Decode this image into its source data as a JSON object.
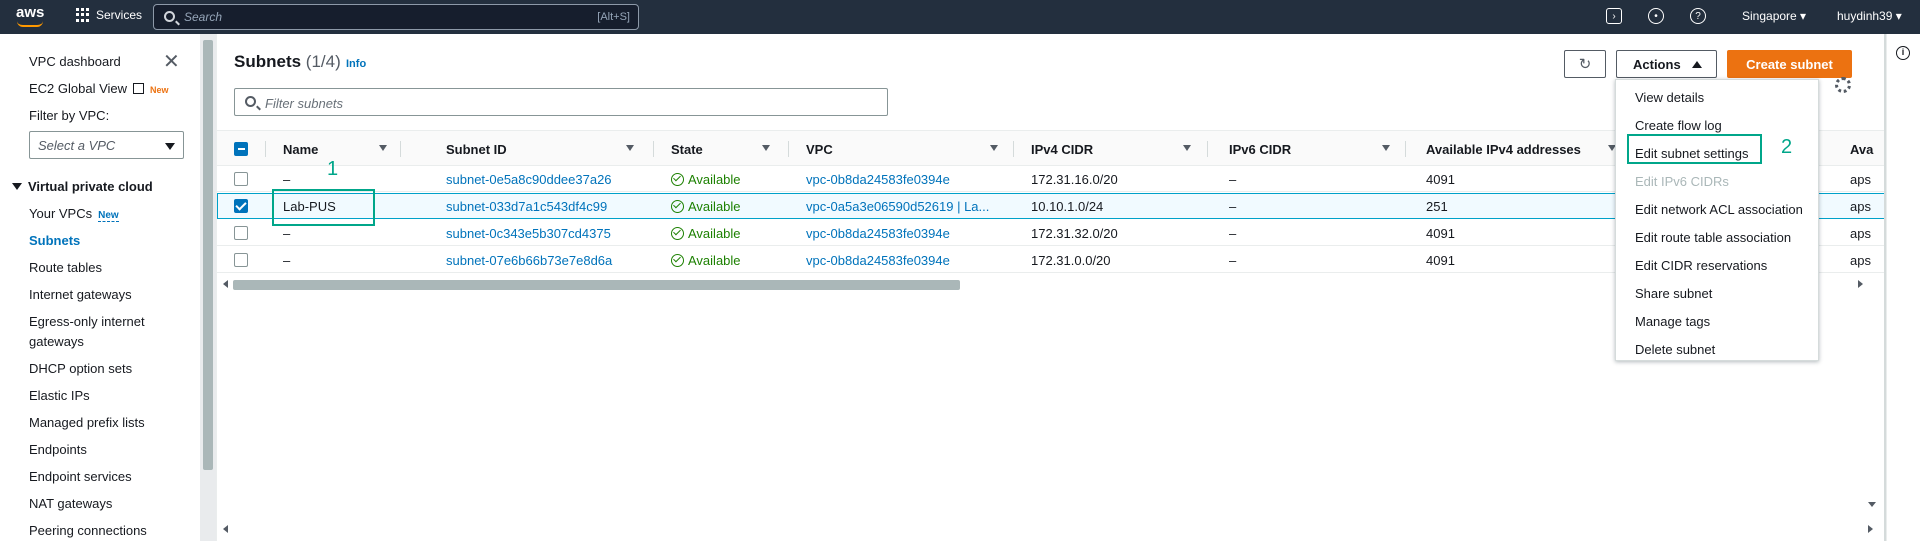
{
  "topbar": {
    "logo_text": "aws",
    "services_label": "Services",
    "search_placeholder": "Search",
    "search_shortcut": "[Alt+S]",
    "region": "Singapore ▾",
    "user": "huydinh39 ▾"
  },
  "sidebar": {
    "items": [
      {
        "label": "VPC dashboard"
      },
      {
        "label": "EC2 Global View",
        "badge": "New"
      },
      {
        "label": "Filter by VPC:"
      },
      {
        "label": "Virtual private cloud"
      },
      {
        "label": "Your VPCs",
        "badge": "New"
      },
      {
        "label": "Subnets"
      },
      {
        "label": "Route tables"
      },
      {
        "label": "Internet gateways"
      },
      {
        "label": "Egress-only internet"
      },
      {
        "label": "gateways"
      },
      {
        "label": "DHCP option sets"
      },
      {
        "label": "Elastic IPs"
      },
      {
        "label": "Managed prefix lists"
      },
      {
        "label": "Endpoints"
      },
      {
        "label": "Endpoint services"
      },
      {
        "label": "NAT gateways"
      },
      {
        "label": "Peering connections"
      }
    ],
    "vpc_select_placeholder": "Select a VPC"
  },
  "panel": {
    "title": "Subnets",
    "count": "(1/4)",
    "info": "Info",
    "actions_label": "Actions",
    "create_label": "Create subnet",
    "filter_placeholder": "Filter subnets"
  },
  "table": {
    "columns": [
      "Name",
      "Subnet ID",
      "State",
      "VPC",
      "IPv4 CIDR",
      "IPv6 CIDR",
      "Available IPv4 addresses",
      "Ava"
    ],
    "rows": [
      {
        "name": "–",
        "subnet_id": "subnet-0e5a8c90ddee37a26",
        "state": "Available",
        "vpc": "vpc-0b8da24583fe0394e",
        "ipv4": "172.31.16.0/20",
        "ipv6": "–",
        "available": "4091",
        "az": "aps",
        "selected": false
      },
      {
        "name": "Lab-PUS",
        "subnet_id": "subnet-033d7a1c543df4c99",
        "state": "Available",
        "vpc": "vpc-0a5a3e06590d52619 | La...",
        "ipv4": "10.10.1.0/24",
        "ipv6": "–",
        "available": "251",
        "az": "aps",
        "selected": true
      },
      {
        "name": "–",
        "subnet_id": "subnet-0c343e5b307cd4375",
        "state": "Available",
        "vpc": "vpc-0b8da24583fe0394e",
        "ipv4": "172.31.32.0/20",
        "ipv6": "–",
        "available": "4091",
        "az": "aps",
        "selected": false
      },
      {
        "name": "–",
        "subnet_id": "subnet-07e6b66b73e7e8d6a",
        "state": "Available",
        "vpc": "vpc-0b8da24583fe0394e",
        "ipv4": "172.31.0.0/20",
        "ipv6": "–",
        "available": "4091",
        "az": "aps",
        "selected": false
      }
    ]
  },
  "actions_menu": {
    "items": [
      {
        "label": "View details",
        "disabled": false
      },
      {
        "label": "Create flow log",
        "disabled": false
      },
      {
        "label": "Edit subnet settings",
        "disabled": false
      },
      {
        "label": "Edit IPv6 CIDRs",
        "disabled": true
      },
      {
        "label": "Edit network ACL association",
        "disabled": false
      },
      {
        "label": "Edit route table association",
        "disabled": false
      },
      {
        "label": "Edit CIDR reservations",
        "disabled": false
      },
      {
        "label": "Share subnet",
        "disabled": false
      },
      {
        "label": "Manage tags",
        "disabled": false
      },
      {
        "label": "Delete subnet",
        "disabled": false
      }
    ]
  },
  "annotations": {
    "step1": "1",
    "step2": "2"
  },
  "colors": {
    "topbar": "#232f3e",
    "primary_button": "#ec7211",
    "link": "#0073bb",
    "available": "#1d8102",
    "annotation": "#00a68a"
  }
}
